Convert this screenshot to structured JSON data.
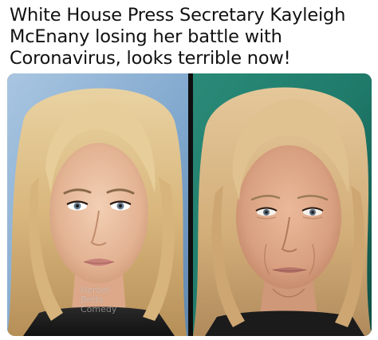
{
  "caption": {
    "lines": [
      "White House Press Secretary Kayleigh",
      "McEnany losing her battle with",
      "Coronavirus, looks terrible now!"
    ]
  },
  "photos": {
    "left": {
      "icon": "portrait-photo-blonde-woman-young"
    },
    "right": {
      "icon": "portrait-photo-blonde-woman-older"
    }
  },
  "watermark": {
    "lines": [
      "Herbel",
      "Betts",
      "Comedy"
    ]
  },
  "colors": {
    "background": "#ffffff",
    "text": "#111111",
    "divider": "#0f0f0f",
    "left_backdrop": "#8fb3d6",
    "right_backdrop": "#1f7a6a"
  }
}
